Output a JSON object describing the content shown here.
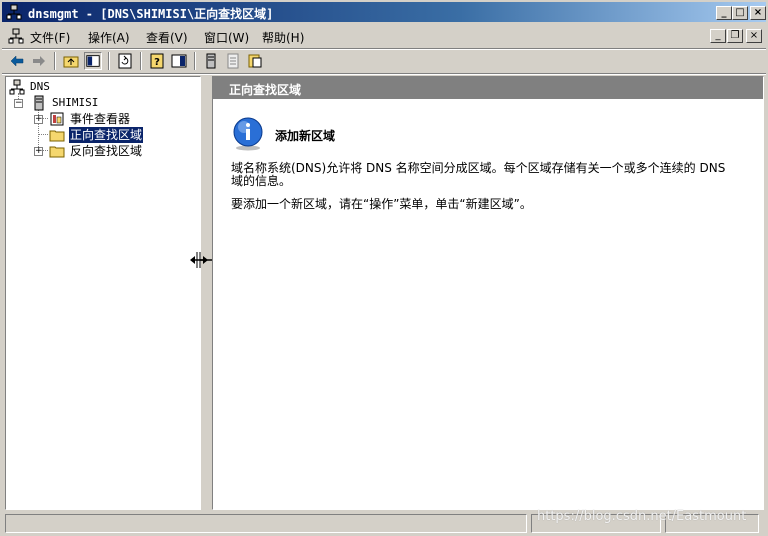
{
  "window": {
    "title": "dnsmgmt - [DNS\\SHIMISI\\正向查找区域]"
  },
  "menubar": {
    "items": [
      "文件(F)",
      "操作(A)",
      "查看(V)",
      "窗口(W)",
      "帮助(H)"
    ]
  },
  "tree": {
    "root": "DNS",
    "server": "SHIMISI",
    "children": [
      "事件查看器",
      "正向查找区域",
      "反向查找区域"
    ],
    "selected": "正向查找区域"
  },
  "details": {
    "header": "正向查找区域",
    "heading": "添加新区域",
    "para1": "域名称系统(DNS)允许将 DNS 名称空间分成区域。每个区域存储有关一个或多个连续的 DNS 域的信息。",
    "para2": "要添加一个新区域，请在“操作”菜单，单击“新建区域”。"
  },
  "watermark": "https://blog.csdn.net/Eastmount",
  "colors": {
    "title_start": "#0a246a",
    "title_end": "#a6caf0",
    "selection": "#0a246a",
    "header_bg": "#808080"
  }
}
